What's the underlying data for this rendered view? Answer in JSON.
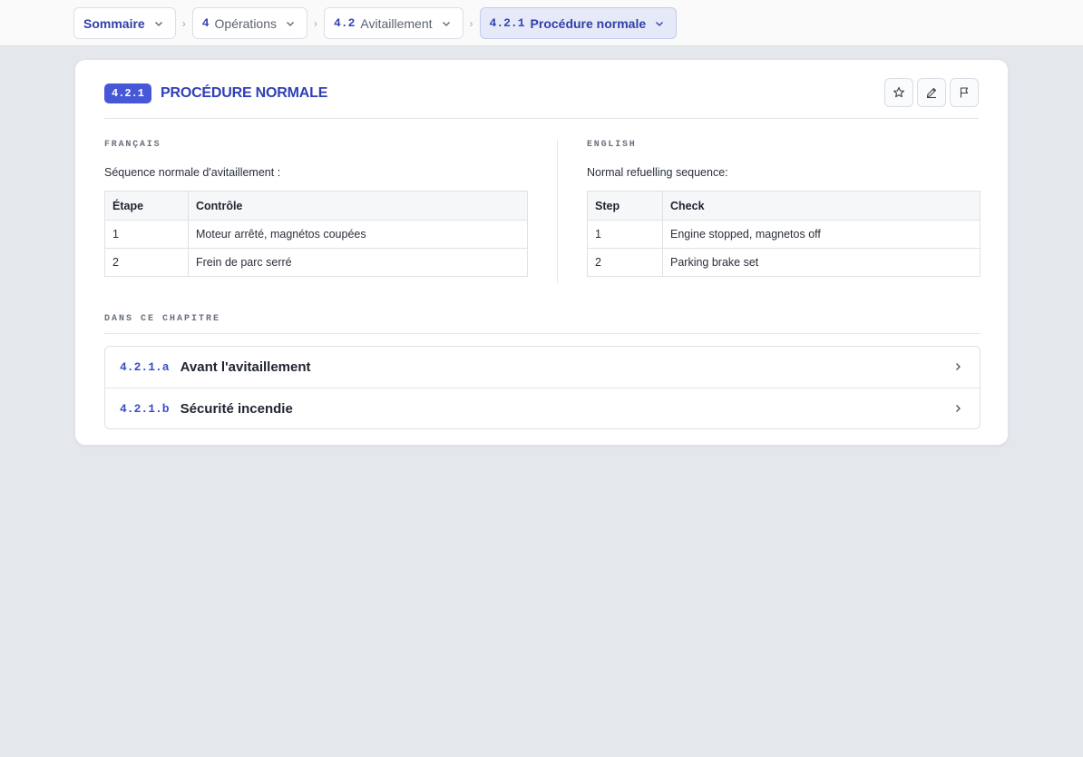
{
  "breadcrumb": {
    "root": {
      "label": "Sommaire"
    },
    "items": [
      {
        "num": "4",
        "label": "Opérations"
      },
      {
        "num": "4.2",
        "label": "Avitaillement"
      },
      {
        "num": "4.2.1",
        "label": "Procédure normale"
      }
    ]
  },
  "section": {
    "number": "4.2.1",
    "title": "PROCÉDURE NORMALE",
    "actions": {
      "favorite_icon": "star-icon",
      "edit_icon": "pencil-icon",
      "flag_icon": "flag-icon"
    }
  },
  "french": {
    "lang_label": "FRANÇAIS",
    "intro": "Séquence normale d'avitaillement :",
    "headers": [
      "Étape",
      "Contrôle"
    ],
    "rows": [
      [
        "1",
        "Moteur arrêté, magnétos coupées"
      ],
      [
        "2",
        "Frein de parc serré"
      ]
    ]
  },
  "english": {
    "lang_label": "ENGLISH",
    "intro": "Normal refuelling sequence:",
    "headers": [
      "Step",
      "Check"
    ],
    "rows": [
      [
        "1",
        "Engine stopped, magnetos off"
      ],
      [
        "2",
        "Parking brake set"
      ]
    ]
  },
  "chapter": {
    "label": "DANS CE CHAPITRE",
    "items": [
      {
        "code": "4.2.1.a",
        "title": "Avant l'avitaillement"
      },
      {
        "code": "4.2.1.b",
        "title": "Sécurité incendie"
      }
    ]
  },
  "colors": {
    "accent": "#4658d8",
    "title": "#2f3fb5",
    "background": "#e4e7ec"
  }
}
